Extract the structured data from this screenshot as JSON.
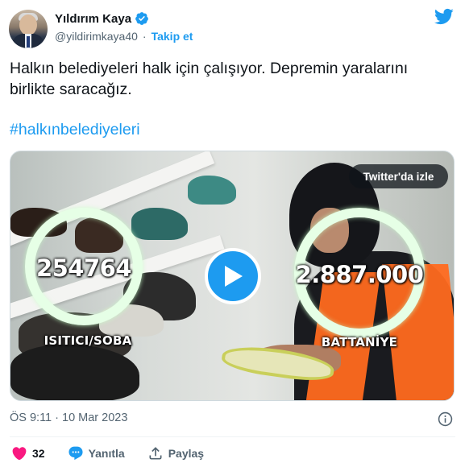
{
  "author": {
    "display_name": "Yıldırım Kaya",
    "handle": "@yildirimkaya40",
    "separator": "·",
    "follow_label": "Takip et",
    "verified": true
  },
  "tweet": {
    "text": "Halkın belediyeleri halk için çalışıyor. Depremin yaralarını birlikte saracağız.",
    "hashtag": "#halkınbelediyeleri"
  },
  "media": {
    "watch_on_twitter": "Twitter'da izle",
    "overlays": [
      {
        "number": "254764",
        "label": "ISITICI/SOBA"
      },
      {
        "number": "2.887.000",
        "label": "BATTANİYE"
      }
    ]
  },
  "timestamp": "ÖS 9:11 · 10 Mar 2023",
  "actions": {
    "like_count": "32",
    "reply_label": "Yanıtla",
    "share_label": "Paylaş"
  },
  "colors": {
    "accent": "#1d9bf0",
    "like": "#f91880",
    "secondary_text": "#536471",
    "primary_text": "#0f1419"
  },
  "icons": [
    "verified-badge-icon",
    "twitter-bird-icon",
    "play-icon",
    "info-icon",
    "heart-icon",
    "reply-icon",
    "share-icon"
  ]
}
